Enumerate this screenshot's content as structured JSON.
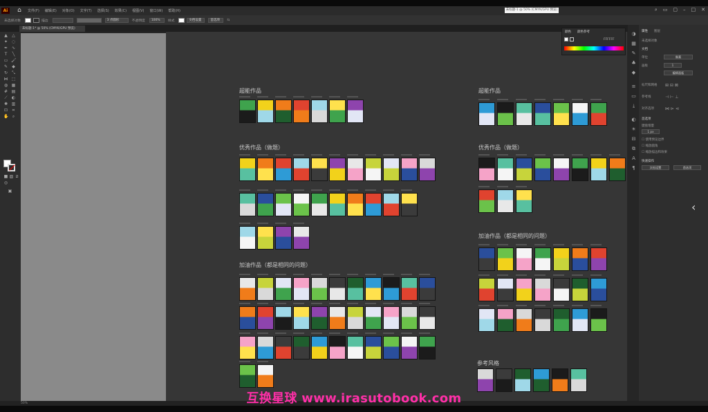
{
  "app": {
    "logo": "Ai",
    "title_box": "未标题-1 @ 50% (CMYK/GPU 预览)",
    "menus": [
      "文件(F)",
      "编辑(E)",
      "对象(O)",
      "文字(T)",
      "选择(S)",
      "效果(C)",
      "视图(V)",
      "窗口(W)",
      "帮助(H)"
    ],
    "document_tab": "未标题-1* @ 50% (CMYK/GPU 预览)",
    "status_zoom": "50%",
    "watermark": "互换星球 www.irasutobook.com"
  },
  "controlbar": {
    "selection_label": "未选择对象",
    "stroke_label": "描边",
    "stroke_value": "3 点圆形",
    "opacity_label": "不透明度",
    "opacity_value": "100%",
    "style_label": "样式",
    "doc_setup": "文档设置",
    "prefs": "首选项"
  },
  "color_panel": {
    "tab1": "颜色",
    "tab2": "颜色参考",
    "hex": "FFFFFF"
  },
  "properties": {
    "tab1": "属性",
    "tab2": "图层",
    "no_selection": "未选择对象",
    "doc_section": "文档",
    "unit_label": "单位",
    "unit_value": "像素",
    "artboard_label": "画板",
    "artboard_value": "1",
    "edit_artboard": "编辑画板",
    "rulers": "标尺和网格",
    "guides": "参考线",
    "align": "对齐选项",
    "prefs": "首选项",
    "keyboard_increment": "键盘增量",
    "increment_value": "1 px",
    "cb1": "使用预览边界",
    "cb2": "缩放圆角",
    "cb3": "缩放描边和效果",
    "quick_actions": "快速操作",
    "btn1": "文档设置",
    "btn2": "首选项"
  },
  "sections": [
    {
      "key": "s1",
      "title": "超能作品"
    },
    {
      "key": "s2",
      "title": "优秀作品（做题）"
    },
    {
      "key": "s3",
      "title": "加油作品（都是相同的问题）"
    },
    {
      "key": "s4",
      "title": "超能作品"
    },
    {
      "key": "s5",
      "title": "优秀作品（做题）"
    },
    {
      "key": "s6",
      "title": "加油作品（都是相同的问题）"
    },
    {
      "key": "s7",
      "title": "参考风格"
    }
  ],
  "colors": {
    "accent_pink": "#ff2fa8",
    "canvas": "#363636",
    "artboard": "#8a8a8a",
    "panel": "#2e2e2e"
  }
}
